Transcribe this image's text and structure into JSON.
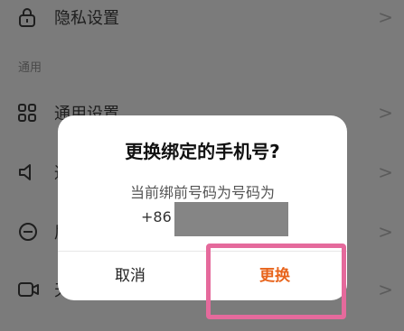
{
  "settings_list": {
    "privacy_label": "隐私设置",
    "section_general": "通用",
    "general_settings_label": "通用设置",
    "row3_label_partial": "通",
    "row4_label_partial": "屏",
    "row5_label_partial": "天"
  },
  "dialog": {
    "title": "更换绑定的手机号?",
    "message": "当前绑前号码为号码为",
    "phone_prefix": "+86",
    "cancel_label": "取消",
    "confirm_label": "更换"
  },
  "colors": {
    "overlay_bg": "#7b7b7b",
    "dialog_bg": "#ffffff",
    "accent": "#e8641c",
    "highlight": "#e56a9c"
  }
}
